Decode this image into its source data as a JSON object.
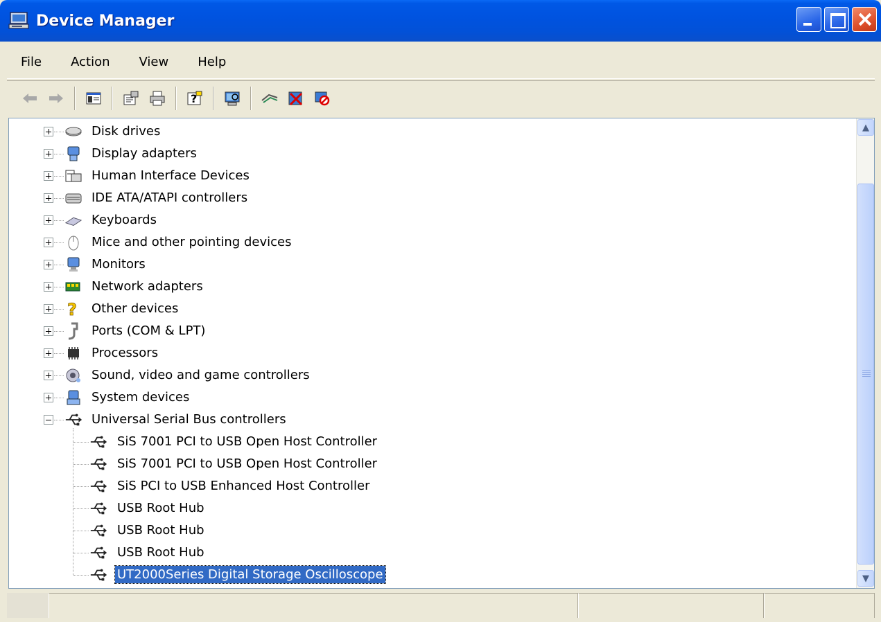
{
  "window": {
    "title": "Device Manager",
    "icon": "computer-icon",
    "controls": [
      "minimize",
      "maximize",
      "close"
    ]
  },
  "menu": [
    "File",
    "Action",
    "View",
    "Help"
  ],
  "toolbar": [
    {
      "name": "back-icon",
      "glyph": "←"
    },
    {
      "name": "forward-icon",
      "glyph": "→"
    },
    {
      "name": "show-hide-console-tree-icon",
      "glyph": "▤"
    },
    {
      "name": "properties-icon",
      "glyph": "▦"
    },
    {
      "name": "print-icon",
      "glyph": "⎙"
    },
    {
      "name": "help-icon",
      "glyph": "?"
    },
    {
      "name": "scan-hardware-icon",
      "glyph": "▣"
    },
    {
      "name": "update-driver-icon",
      "glyph": "≈"
    },
    {
      "name": "uninstall-icon",
      "glyph": "✕"
    },
    {
      "name": "disable-icon",
      "glyph": "⊘"
    }
  ],
  "tree": {
    "categories": [
      {
        "label": "Disk drives",
        "icon": "disk-drive-icon",
        "expanded": false
      },
      {
        "label": "Display adapters",
        "icon": "display-adapter-icon",
        "expanded": false
      },
      {
        "label": "Human Interface Devices",
        "icon": "hid-icon",
        "expanded": false
      },
      {
        "label": "IDE ATA/ATAPI controllers",
        "icon": "ide-controller-icon",
        "expanded": false
      },
      {
        "label": "Keyboards",
        "icon": "keyboard-icon",
        "expanded": false
      },
      {
        "label": "Mice and other pointing devices",
        "icon": "mouse-icon",
        "expanded": false
      },
      {
        "label": "Monitors",
        "icon": "monitor-icon",
        "expanded": false
      },
      {
        "label": "Network adapters",
        "icon": "network-adapter-icon",
        "expanded": false
      },
      {
        "label": "Other devices",
        "icon": "unknown-device-icon",
        "expanded": false
      },
      {
        "label": "Ports (COM & LPT)",
        "icon": "port-icon",
        "expanded": false
      },
      {
        "label": "Processors",
        "icon": "processor-icon",
        "expanded": false
      },
      {
        "label": "Sound, video and game controllers",
        "icon": "sound-icon",
        "expanded": false
      },
      {
        "label": "System devices",
        "icon": "system-device-icon",
        "expanded": false
      },
      {
        "label": "Universal Serial Bus controllers",
        "icon": "usb-icon",
        "expanded": true
      }
    ],
    "usb_children": [
      {
        "label": "SiS 7001 PCI to USB Open Host Controller",
        "selected": false
      },
      {
        "label": "SiS 7001 PCI to USB Open Host Controller",
        "selected": false
      },
      {
        "label": "SiS PCI to USB Enhanced Host Controller",
        "selected": false
      },
      {
        "label": "USB Root Hub",
        "selected": false
      },
      {
        "label": "USB Root Hub",
        "selected": false
      },
      {
        "label": "USB Root Hub",
        "selected": false
      },
      {
        "label": "UT2000Series Digital Storage Oscilloscope",
        "selected": true
      }
    ]
  },
  "colors": {
    "titlebar": "#0054E3",
    "selection": "#316AC5",
    "chrome": "#ECE9D8"
  }
}
